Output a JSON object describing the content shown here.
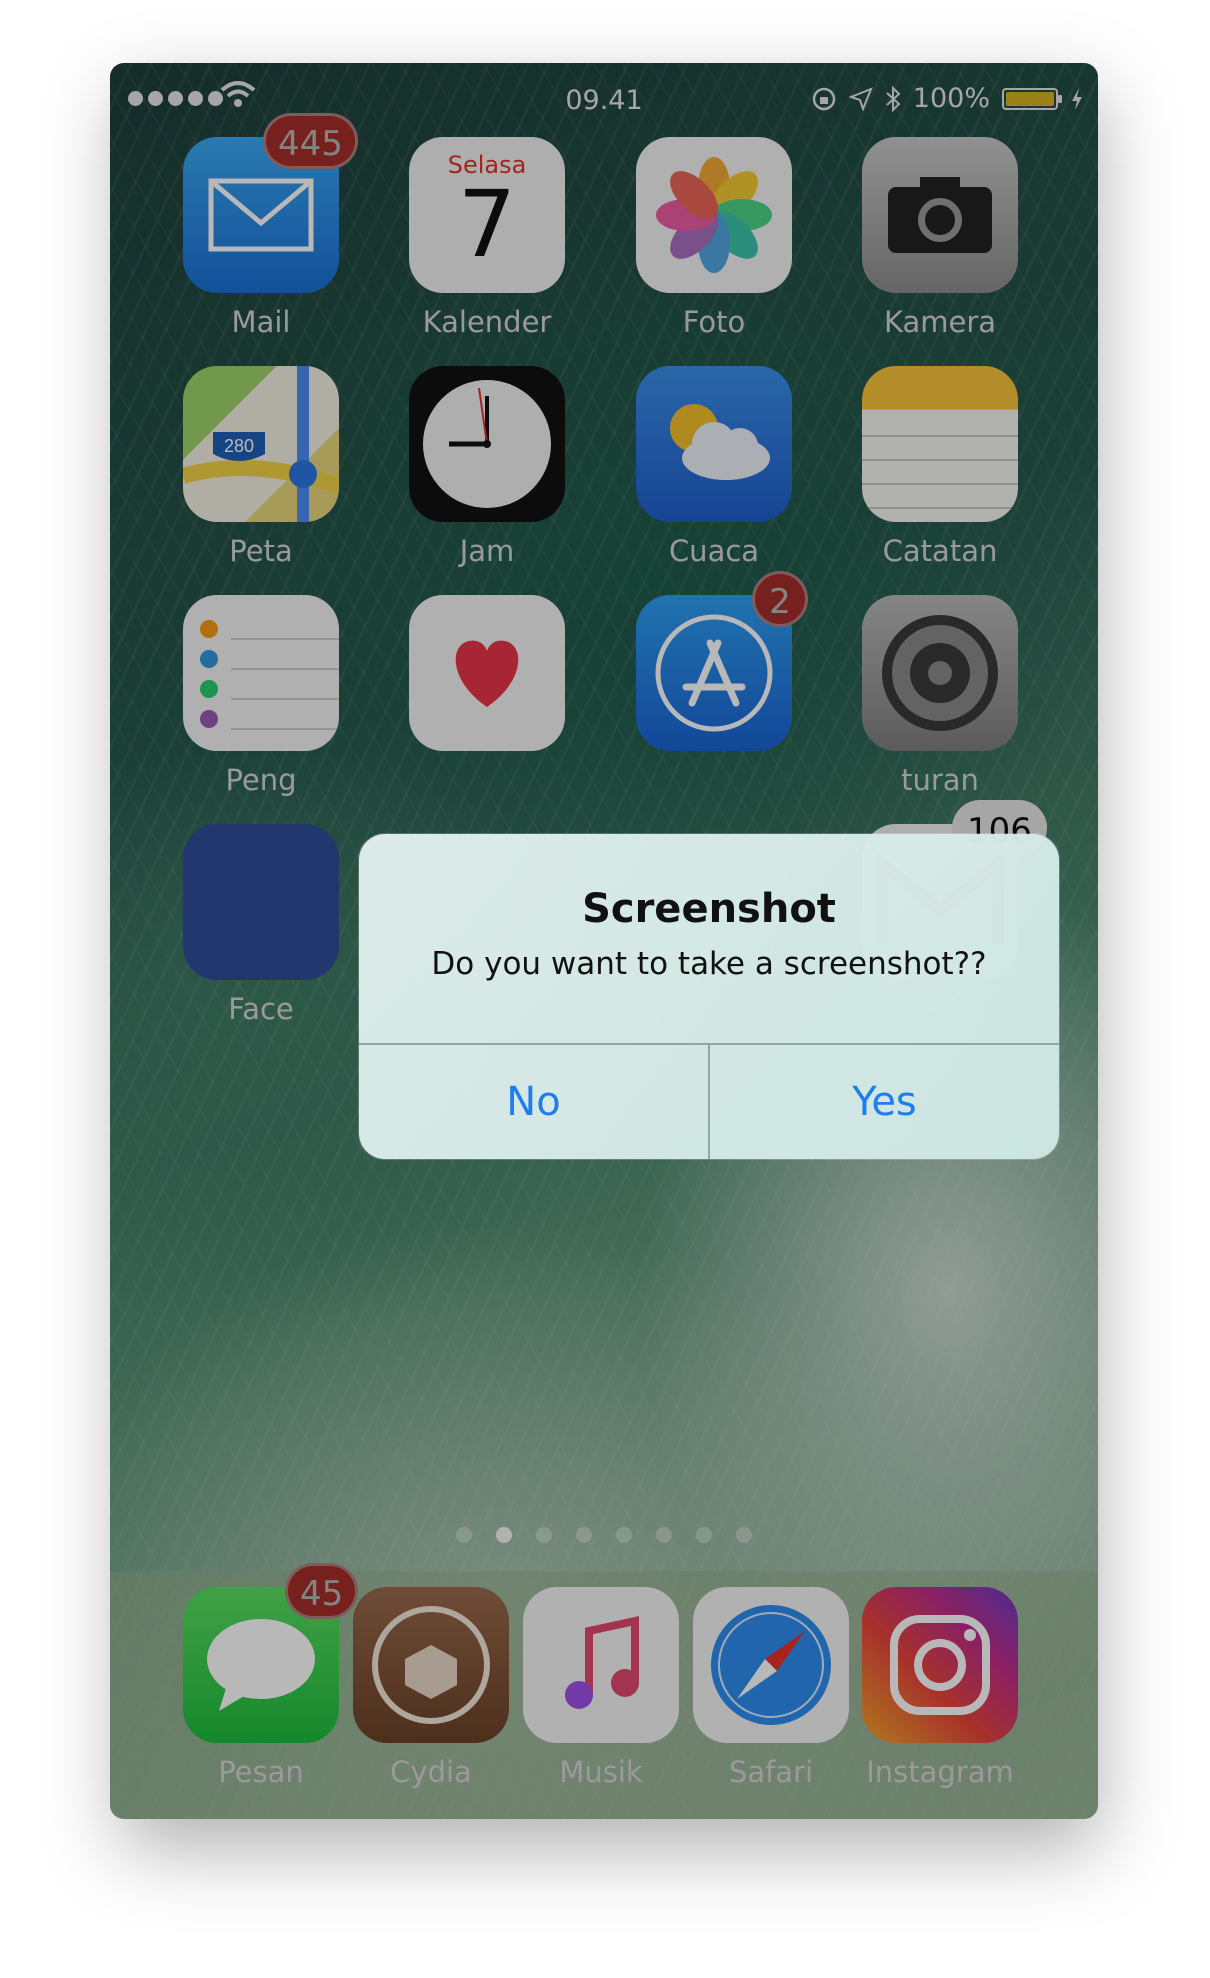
{
  "status_bar": {
    "time": "09.41",
    "battery": "100%"
  },
  "apps": [
    {
      "label": "Mail",
      "badge": "445"
    },
    {
      "label": "Kalender",
      "day_name": "Selasa",
      "day_number": "7"
    },
    {
      "label": "Foto"
    },
    {
      "label": "Kamera"
    },
    {
      "label": "Peta",
      "shield": "280"
    },
    {
      "label": "Jam"
    },
    {
      "label": "Cuaca"
    },
    {
      "label": "Catatan"
    },
    {
      "label": "Peng"
    },
    {
      "label": ""
    },
    {
      "label": "",
      "badge": "2"
    },
    {
      "label": "turan"
    },
    {
      "label": "Face"
    },
    {
      "label": "ail",
      "badge": "106"
    }
  ],
  "alert": {
    "title": "Screenshot",
    "message": "Do you want to take a screenshot??",
    "no_label": "No",
    "yes_label": "Yes"
  },
  "page_indicator": {
    "count": 8,
    "active_index": 1
  },
  "dock": [
    {
      "label": "Pesan",
      "badge": "45"
    },
    {
      "label": "Cydia"
    },
    {
      "label": "Musik"
    },
    {
      "label": "Safari"
    },
    {
      "label": "Instagram"
    }
  ],
  "colors": {
    "alert_button": "#1e7ef0",
    "badge": "#e6403a"
  }
}
